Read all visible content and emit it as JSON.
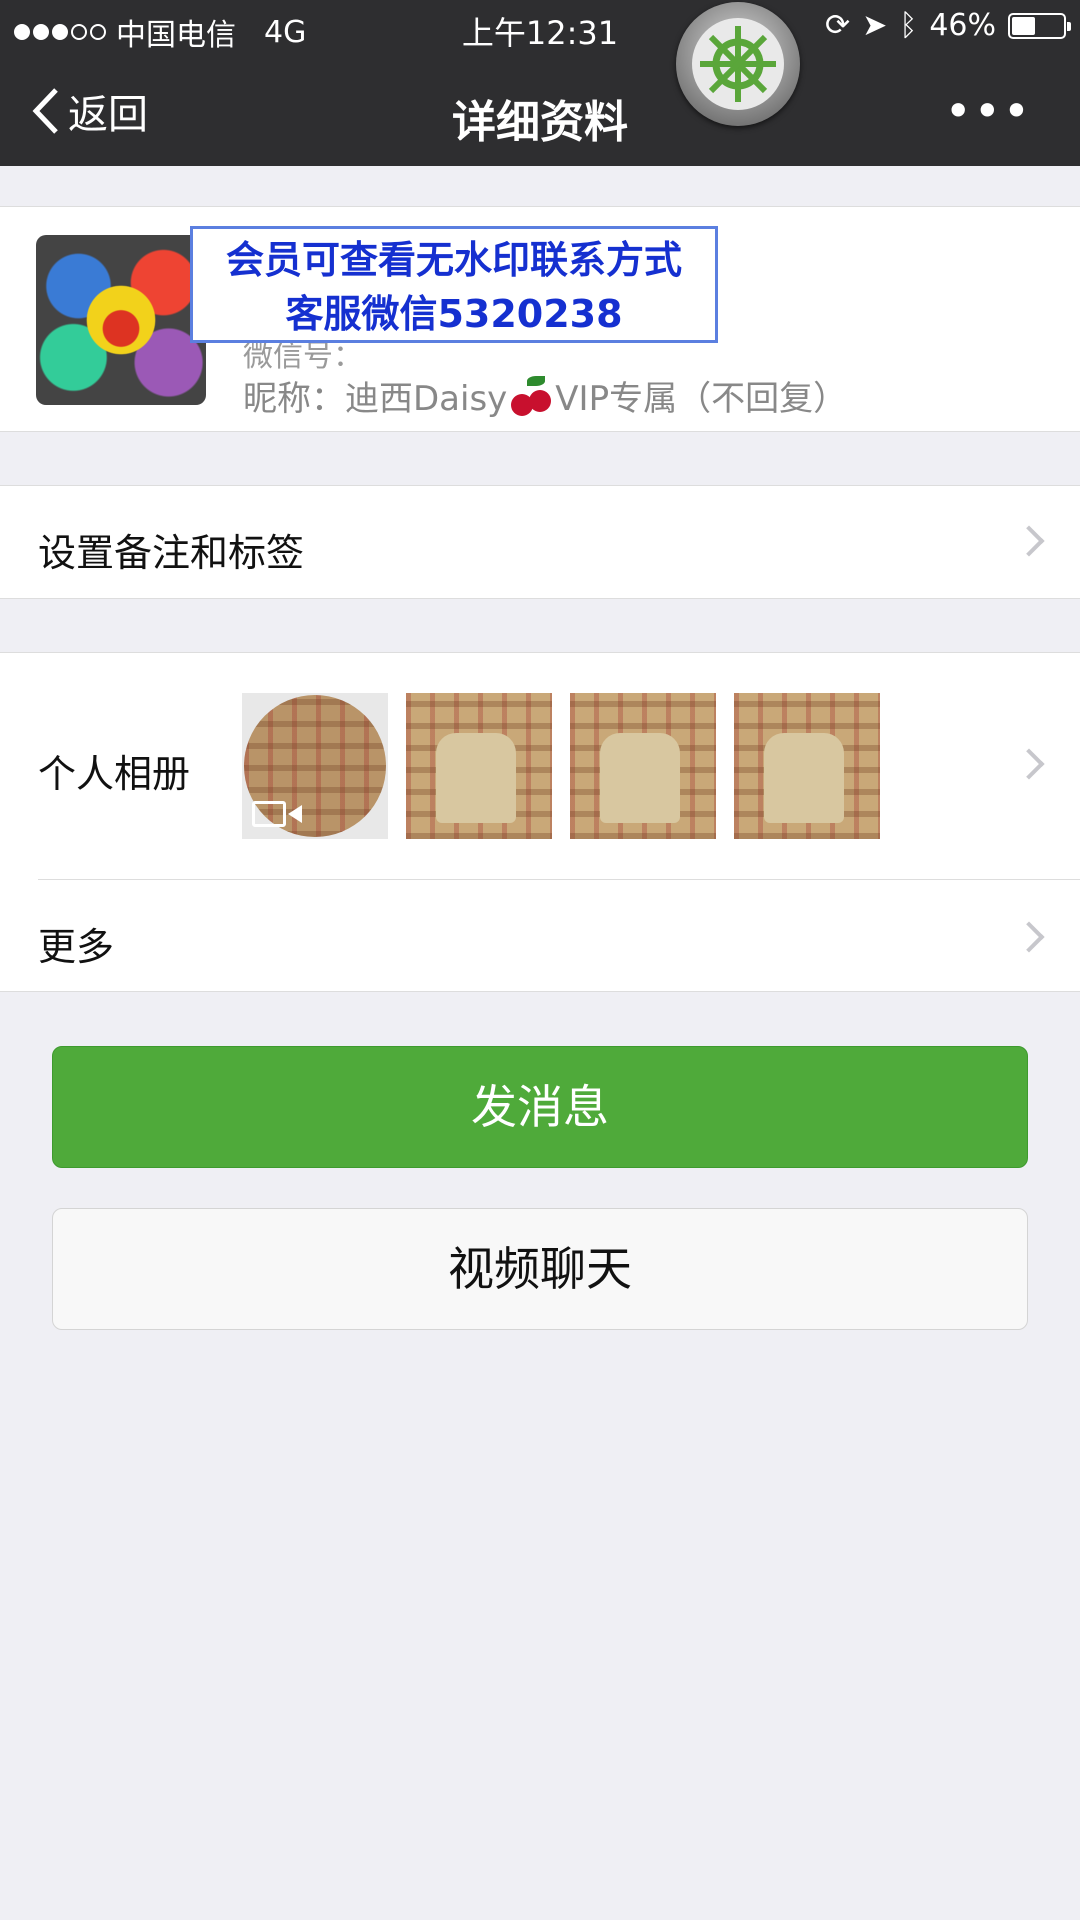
{
  "status_bar": {
    "carrier": "中国电信",
    "network": "4G",
    "time": "上午12:31",
    "battery": "46%",
    "battery_level": 0.46
  },
  "nav": {
    "back_label": "返回",
    "title": "详细资料",
    "more_label": "•••"
  },
  "profile": {
    "hidden_line": "微信号：",
    "nickname_label": "昵称：",
    "nickname_name": "迪西Daisy",
    "nickname_suffix": "VIP专属（不回复）"
  },
  "watermark": {
    "line1": "会员可查看无水印联系方式",
    "line2": "客服微信5320238"
  },
  "rows": {
    "remark": "设置备注和标签",
    "album": "个人相册",
    "more": "更多"
  },
  "buttons": {
    "send": "发消息",
    "video": "视频聊天"
  },
  "icons": [
    "chevron-left-icon",
    "more-dots-icon",
    "chevron-right-icon",
    "video-camera-icon",
    "cherry-icon",
    "ship-wheel-icon"
  ]
}
